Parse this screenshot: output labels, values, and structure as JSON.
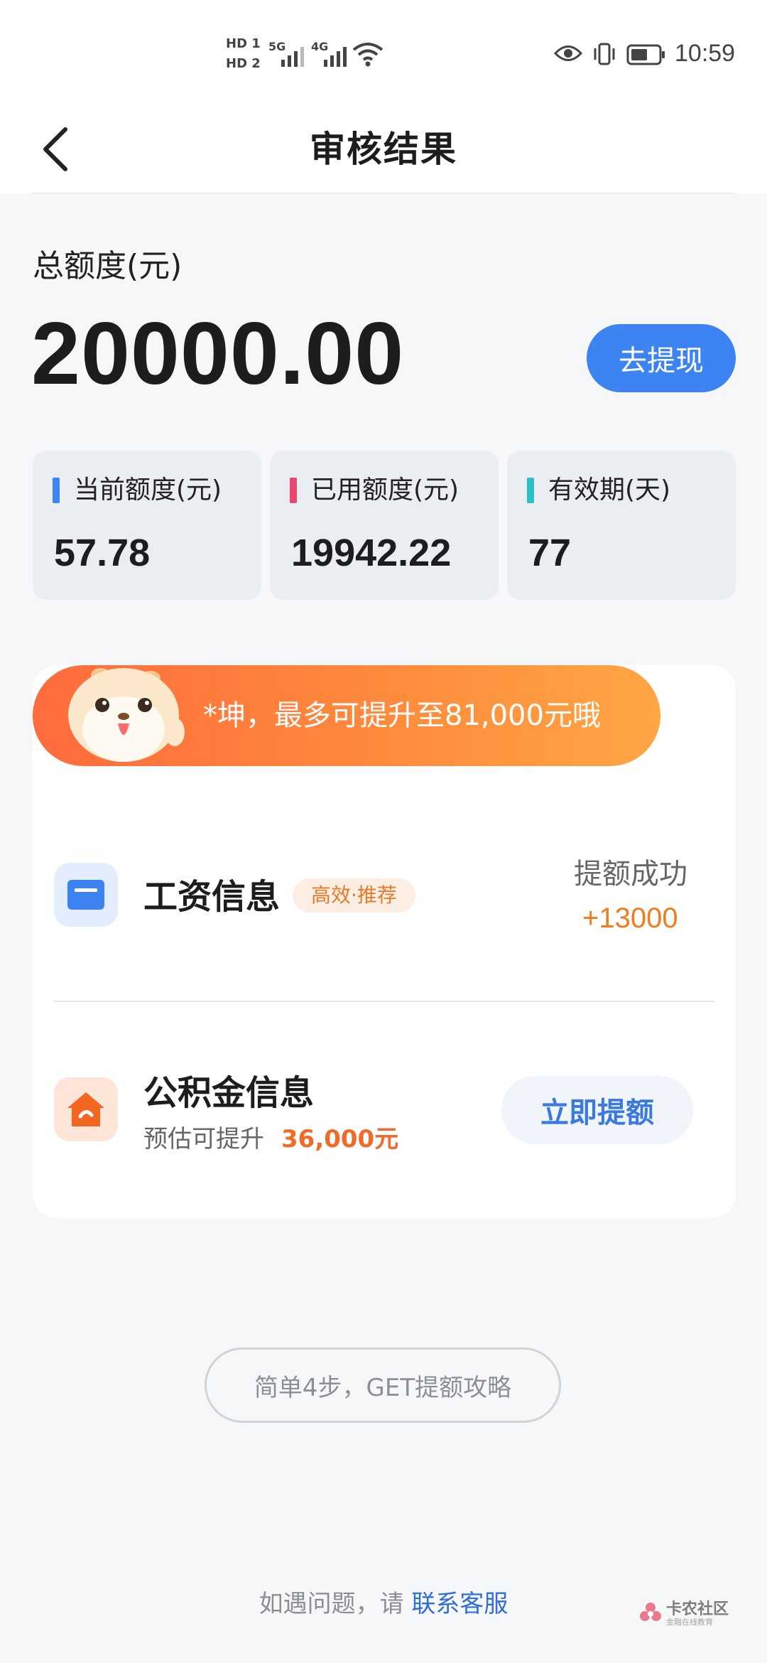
{
  "status_bar": {
    "hd1": "HD 1",
    "hd2": "HD 2",
    "net1": "5G",
    "net2": "4G",
    "time": "10:59"
  },
  "nav": {
    "title": "审核结果"
  },
  "summary": {
    "total_label": "总额度(元)",
    "total_amount": "20000.00",
    "withdraw_label": "去提现"
  },
  "stats": [
    {
      "label": "当前额度(元)",
      "value": "57.78",
      "color": "#3d83f2"
    },
    {
      "label": "已用额度(元)",
      "value": "19942.22",
      "color": "#e94874"
    },
    {
      "label": "有效期(天)",
      "value": "77",
      "color": "#2bbfc6"
    }
  ],
  "promo": {
    "text": "*坤，最多可提升至81,000元哦"
  },
  "salary": {
    "title": "工资信息",
    "tag": "高效·推荐",
    "status": "提额成功",
    "amount": "+13000"
  },
  "fund": {
    "title": "公积金信息",
    "subtitle": "预估可提升",
    "amount": "36,000元",
    "button": "立即提额"
  },
  "guide": {
    "label": "简单4步，GET提额攻略"
  },
  "footer": {
    "prefix": "如遇问题，请",
    "link": "联系客服"
  },
  "watermark": {
    "title": "卡农社区",
    "sub": "金融在线教育"
  },
  "colors": {
    "accent": "#3d83f2",
    "orange": "#f07c1c",
    "background": "#f6f7f9"
  }
}
